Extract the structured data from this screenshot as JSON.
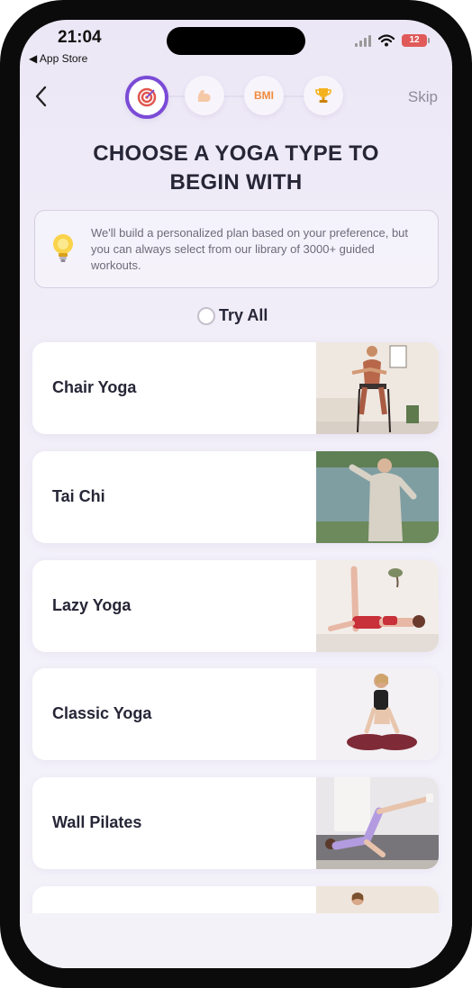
{
  "status_bar": {
    "time": "21:04",
    "back_app": "◀ App Store",
    "battery": "12"
  },
  "header": {
    "skip_label": "Skip",
    "steps": [
      "target-icon",
      "muscle-icon",
      "BMI",
      "trophy-icon"
    ]
  },
  "title_line1": "CHOOSE A YOGA TYPE TO",
  "title_line2": "BEGIN WITH",
  "info": {
    "text": "We'll build a personalized plan based on your preference, but you can always select from our library of 3000+ guided workouts."
  },
  "try_all": {
    "label": "Try All",
    "checked": false
  },
  "options": [
    {
      "label": "Chair Yoga"
    },
    {
      "label": "Tai Chi"
    },
    {
      "label": "Lazy Yoga"
    },
    {
      "label": "Classic Yoga"
    },
    {
      "label": "Wall Pilates"
    }
  ],
  "colors": {
    "accent": "#7b4bd6",
    "text": "#262637",
    "background": "#ece7f6"
  }
}
